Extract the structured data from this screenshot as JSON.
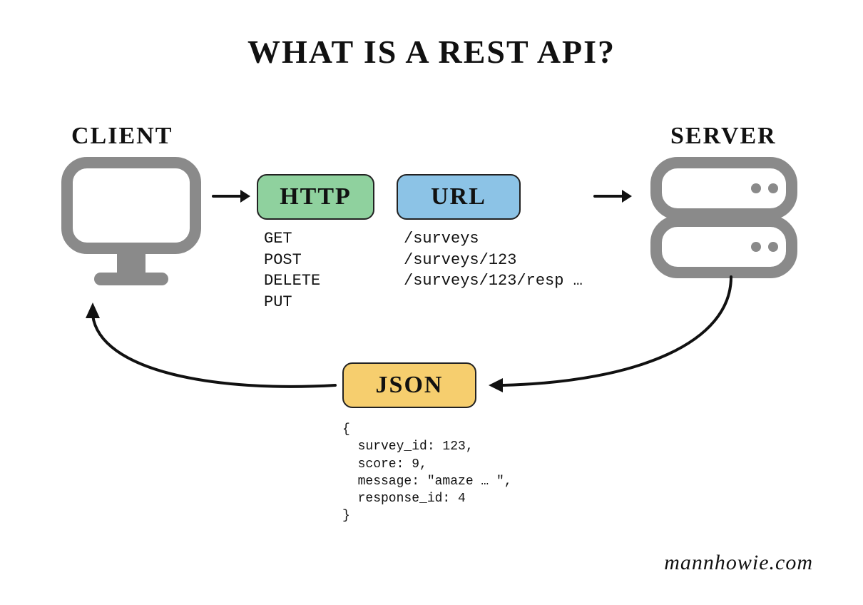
{
  "title": "WHAT IS A REST API?",
  "labels": {
    "client": "CLIENT",
    "server": "SERVER"
  },
  "boxes": {
    "http": "HTTP",
    "url": "URL",
    "json": "JSON"
  },
  "http_methods": "GET\nPOST\nDELETE\nPUT",
  "url_examples": "/surveys\n/surveys/123\n/surveys/123/resp …",
  "json_body": "{\n  survey_id: 123,\n  score: 9,\n  message: \"amaze … \",\n  response_id: 4\n}",
  "attribution": "mannhowie.com",
  "colors": {
    "green": "#8fd19e",
    "blue": "#8cc3e6",
    "yellow": "#f6ce6e",
    "stroke": "#222222",
    "icon": "#8a8a8a"
  }
}
